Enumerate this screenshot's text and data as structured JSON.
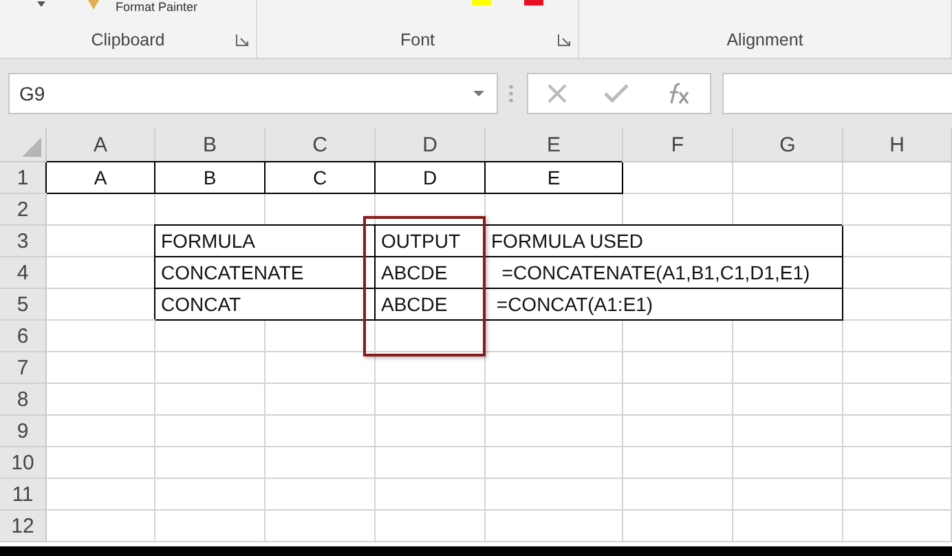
{
  "ribbon": {
    "top_command": "Format Painter",
    "groups": [
      "Clipboard",
      "Font",
      "Alignment"
    ]
  },
  "formula_bar": {
    "name_box": "G9"
  },
  "columns": [
    "A",
    "B",
    "C",
    "D",
    "E",
    "F",
    "G",
    "H"
  ],
  "row_numbers": [
    "1",
    "2",
    "3",
    "4",
    "5",
    "6",
    "7",
    "8",
    "9",
    "10",
    "11",
    "12"
  ],
  "letters_row": [
    "A",
    "B",
    "C",
    "D",
    "E"
  ],
  "table": {
    "headings": [
      "FORMULA",
      "OUTPUT",
      "FORMULA USED"
    ],
    "rows": [
      {
        "function": "CONCATENATE",
        "output": "ABCDE",
        "formula": "  =CONCATENATE(A1,B1,C1,D1,E1)"
      },
      {
        "function": "CONCAT",
        "output": "ABCDE",
        "formula": " =CONCAT(A1:E1)"
      }
    ]
  }
}
